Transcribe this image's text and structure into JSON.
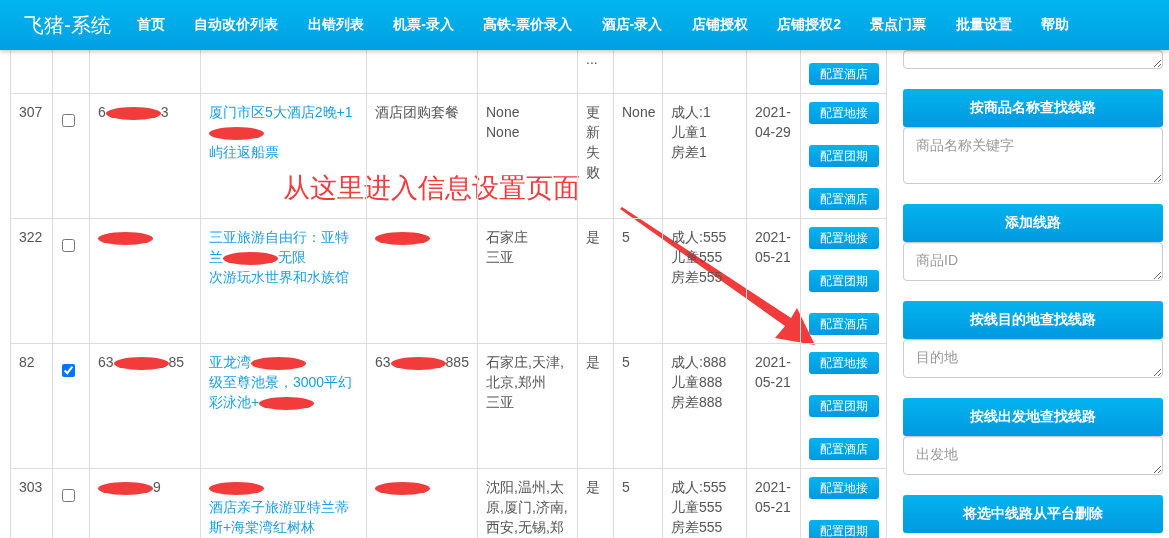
{
  "nav": {
    "brand": "飞猪-系统",
    "items": [
      {
        "label": "首页"
      },
      {
        "label": "自动改价列表"
      },
      {
        "label": "出错列表"
      },
      {
        "label": "机票-录入"
      },
      {
        "label": "高铁-票价录入"
      },
      {
        "label": "酒店-录入"
      },
      {
        "label": "店铺授权"
      },
      {
        "label": "店铺授权2"
      },
      {
        "label": "景点门票"
      },
      {
        "label": "批量设置"
      },
      {
        "label": "帮助"
      }
    ]
  },
  "table": {
    "partial_row": {
      "status": "...",
      "buttons": [
        "配置酒店"
      ]
    },
    "rows": [
      {
        "id": "307",
        "checked": false,
        "code": [
          {
            "text": "6"
          },
          {
            "kind": "redaction"
          },
          {
            "text": "3"
          }
        ],
        "title": [
          [
            {
              "text": "厦门市区5大酒店2晚+1"
            }
          ],
          [
            {
              "kind": "redaction"
            }
          ],
          [
            {
              "text": "屿往返船票"
            }
          ]
        ],
        "column_5": [
          {
            "text": "酒店团购套餐"
          }
        ],
        "cities": [
          "None",
          "None"
        ],
        "status": "更新失败",
        "count": "None",
        "prices": [
          "成人:1",
          "儿童1",
          "房差1"
        ],
        "date": "2021-04-29",
        "buttons": [
          "配置地接",
          "配置团期",
          "配置酒店"
        ]
      },
      {
        "id": "322",
        "checked": false,
        "code": [
          {
            "kind": "redaction"
          }
        ],
        "title": [
          [
            {
              "text": "三亚旅游自由行：亚特"
            }
          ],
          [
            {
              "text": "兰"
            },
            {
              "kind": "redaction"
            },
            {
              "text": "无限"
            }
          ],
          [
            {
              "text": "次游玩水世界和水族馆"
            }
          ]
        ],
        "column_5": [
          {
            "kind": "redaction"
          }
        ],
        "cities": [
          "石家庄",
          "三亚"
        ],
        "status": "是",
        "count": "5",
        "prices": [
          "成人:555",
          "儿童555",
          "房差555"
        ],
        "date": "2021-05-21",
        "buttons": [
          "配置地接",
          "配置团期",
          "配置酒店"
        ]
      },
      {
        "id": "82",
        "checked": true,
        "code": [
          {
            "text": "63"
          },
          {
            "kind": "redaction"
          },
          {
            "text": "85"
          }
        ],
        "title": [
          [
            {
              "text": "亚龙湾"
            },
            {
              "kind": "redaction"
            }
          ],
          [
            {
              "text": "级至尊池景，3000平幻"
            }
          ],
          [
            {
              "text": "彩泳池+"
            },
            {
              "kind": "redaction"
            }
          ]
        ],
        "column_5": [
          {
            "text": "63"
          },
          {
            "kind": "redaction"
          },
          {
            "text": "885"
          }
        ],
        "cities": [
          "石家庄,天津,",
          "北京,郑州",
          "三亚"
        ],
        "status": "是",
        "count": "5",
        "prices": [
          "成人:888",
          "儿童888",
          "房差888"
        ],
        "date": "2021-05-21",
        "buttons": [
          "配置地接",
          "配置团期",
          "配置酒店"
        ]
      },
      {
        "id": "303",
        "checked": false,
        "code": [
          {
            "kind": "redaction"
          },
          {
            "text": "9"
          }
        ],
        "title": [
          [
            {
              "kind": "redaction"
            }
          ],
          [
            {
              "text": "酒店亲子旅游亚特兰蒂"
            }
          ],
          [
            {
              "text": "斯+海棠湾红树林"
            }
          ]
        ],
        "column_5": [
          {
            "kind": "redaction"
          }
        ],
        "cities": [
          "沈阳,温州,太",
          "原,厦门,济南,",
          "西安,无锡,郑"
        ],
        "status": "是",
        "count": "5",
        "prices": [
          "成人:555",
          "儿童555",
          "房差555"
        ],
        "date": "2021-05-21",
        "buttons": [
          "配置地接",
          "配置团期"
        ]
      }
    ]
  },
  "annotation": {
    "text": "从这里进入信息设置页面"
  },
  "side_panel": {
    "groups": [
      {
        "button": "按商品名称查找线路",
        "placeholder": "商品名称关键字",
        "kind": "tall"
      },
      {
        "button": "添加线路",
        "placeholder": "商品ID",
        "kind": "short"
      },
      {
        "button": "按线目的地查找线路",
        "placeholder": "目的地",
        "kind": "short"
      },
      {
        "button": "按线出发地查找线路",
        "placeholder": "出发地",
        "kind": "short"
      }
    ],
    "delete_button": "将选中线路从平台删除"
  }
}
